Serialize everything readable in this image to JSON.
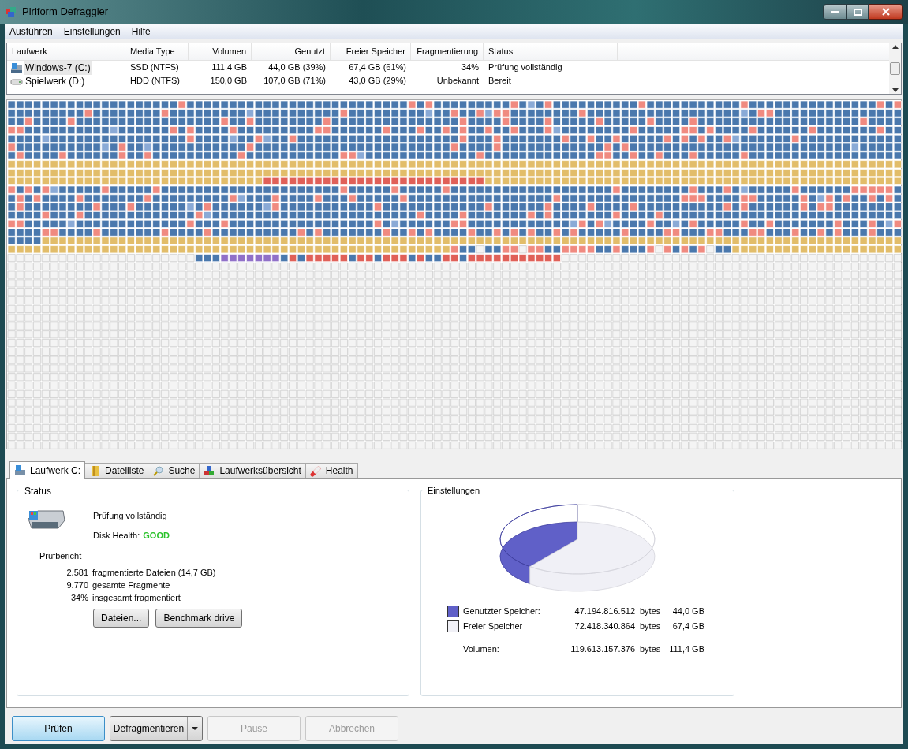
{
  "window": {
    "title": "Piriform Defraggler"
  },
  "menu": [
    "Ausführen",
    "Einstellungen",
    "Hilfe"
  ],
  "drives": {
    "columns": [
      "Laufwerk",
      "Media Type",
      "Volumen",
      "Genutzt",
      "Freier Speicher",
      "Fragmentierung",
      "Status"
    ],
    "rows": [
      {
        "kind": "system",
        "selected": true,
        "cells": [
          "Windows-7 (C:)",
          "SSD (NTFS)",
          "111,4 GB",
          "44,0 GB (39%)",
          "67,4 GB (61%)",
          "34%",
          "Prüfung vollständig"
        ]
      },
      {
        "kind": "hdd",
        "selected": false,
        "cells": [
          "Spielwerk (D:)",
          "HDD (NTFS)",
          "150,0 GB",
          "107,0 GB (71%)",
          "43,0 GB (29%)",
          "Unbekannt",
          "Bereit"
        ]
      }
    ]
  },
  "tabs": [
    {
      "label": "Laufwerk C:",
      "selected": true
    },
    {
      "label": "Dateiliste",
      "selected": false
    },
    {
      "label": "Suche",
      "selected": false
    },
    {
      "label": "Laufwerksübersicht",
      "selected": false
    },
    {
      "label": "Health",
      "selected": false
    }
  ],
  "status_panel": {
    "title": "Status",
    "state": "Prüfung vollständig",
    "health_label": "Disk Health:",
    "health_value": "GOOD",
    "report_title": "Prüfbericht",
    "report": [
      {
        "figure": "2.581",
        "text": "fragmentierte Dateien (14,7 GB)"
      },
      {
        "figure": "9.770",
        "text": "gesamte Fragmente"
      },
      {
        "figure": "34%",
        "text": "insgesamt fragmentiert"
      }
    ],
    "buttons": [
      "Dateien...",
      "Benchmark drive"
    ]
  },
  "settings_panel": {
    "title": "Einstellungen",
    "legend": [
      {
        "label": "Genutzter Speicher:",
        "bytes": "47.194.816.512",
        "unit": "bytes",
        "size": "44,0 GB",
        "color": "#6060c8"
      },
      {
        "label": "Freier Speicher",
        "bytes": "72.418.340.864",
        "unit": "bytes",
        "size": "67,4 GB",
        "color": "#f0f0f6"
      }
    ],
    "total": {
      "label": "Volumen:",
      "bytes": "119.613.157.376",
      "unit": "bytes",
      "size": "111,4 GB"
    }
  },
  "actions": [
    {
      "label": "Prüfen",
      "kind": "default",
      "disabled": false
    },
    {
      "label": "Defragmentieren",
      "kind": "split",
      "disabled": false
    },
    {
      "label": "Pause",
      "kind": "plain",
      "disabled": true
    },
    {
      "label": "Abbrechen",
      "kind": "plain",
      "disabled": true
    }
  ]
}
